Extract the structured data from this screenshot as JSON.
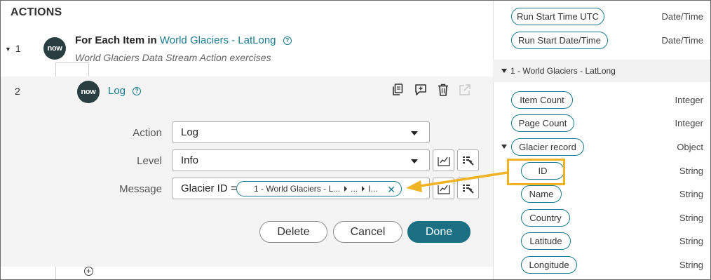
{
  "actions_title": "ACTIONS",
  "step1": {
    "number": "1",
    "logo": "now",
    "title_prefix": "For Each Item in",
    "title_link": "World Glaciers - LatLong",
    "subtitle": "World Glaciers Data Stream Action exercises"
  },
  "step2": {
    "number": "2",
    "logo": "now",
    "title": "Log",
    "toolbar_icons": [
      "copy-icon",
      "add-comment-icon",
      "trash-icon",
      "open-external-icon"
    ]
  },
  "form": {
    "action_label": "Action",
    "action_value": "Log",
    "level_label": "Level",
    "level_value": "Info",
    "message_label": "Message",
    "message_prefix": "Glacier ID =",
    "message_pill": {
      "segment1": "1 - World Glaciers - L...",
      "segment2": "...",
      "segment3": "I..."
    }
  },
  "buttons": {
    "delete": "Delete",
    "cancel": "Cancel",
    "done": "Done"
  },
  "data_panel": {
    "top_pills": [
      {
        "label": "Run Start Time UTC",
        "type": "Date/Time"
      },
      {
        "label": "Run Start Date/Time",
        "type": "Date/Time"
      }
    ],
    "section_label": "1 - World Glaciers - LatLong",
    "section_pills": [
      {
        "label": "Item Count",
        "type": "Integer"
      },
      {
        "label": "Page Count",
        "type": "Integer"
      },
      {
        "label": "Glacier record",
        "type": "Object"
      }
    ],
    "record_fields": [
      {
        "label": "ID",
        "type": "String"
      },
      {
        "label": "Name",
        "type": "String"
      },
      {
        "label": "Country",
        "type": "String"
      },
      {
        "label": "Latitude",
        "type": "String"
      },
      {
        "label": "Longitude",
        "type": "String"
      }
    ]
  },
  "colors": {
    "accent": "#1a7a8f",
    "primary_button": "#1b7083",
    "highlight": "#f0b323",
    "logo_bg": "#293e40"
  }
}
